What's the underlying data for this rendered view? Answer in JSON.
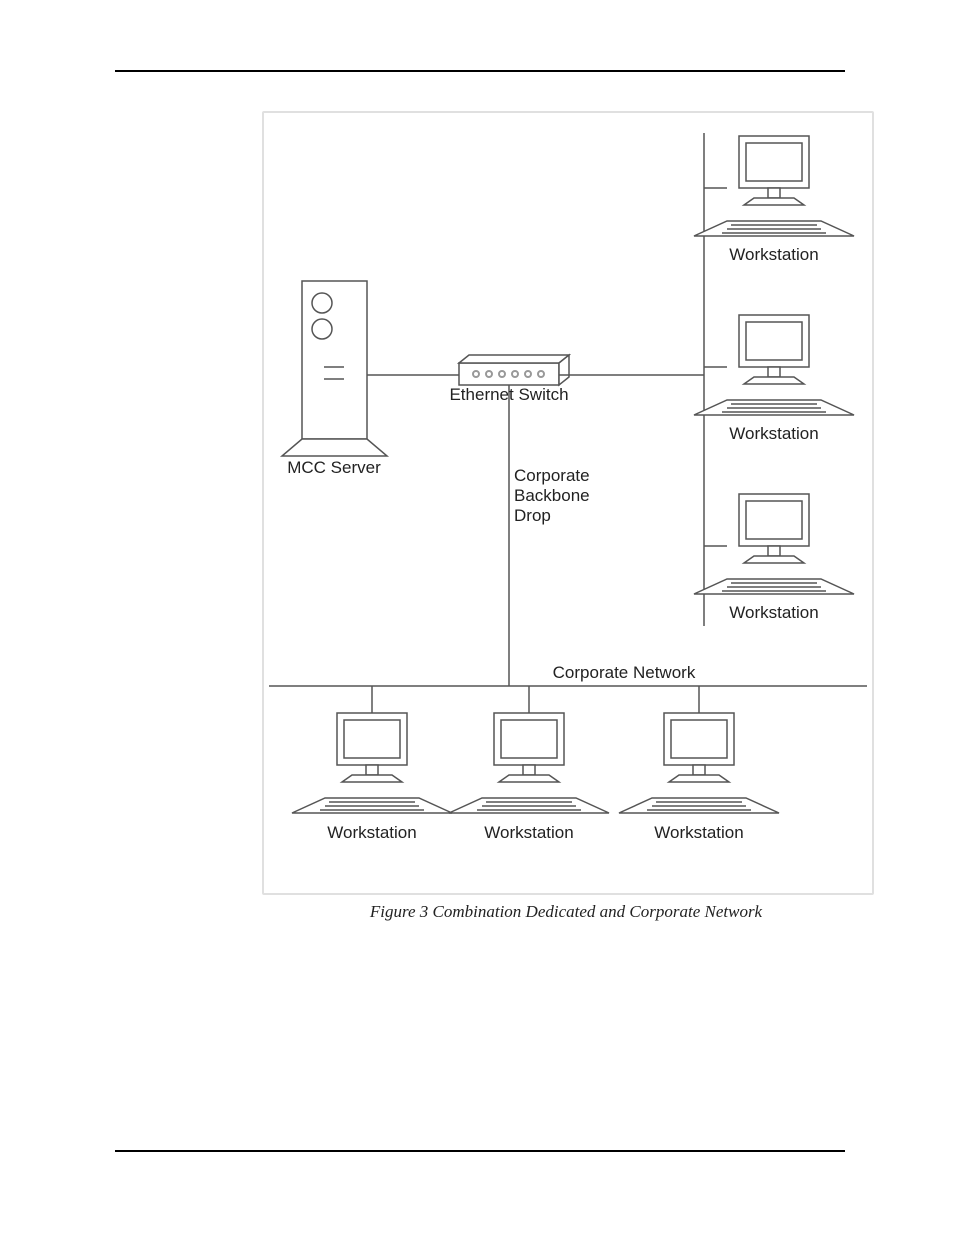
{
  "caption": "Figure 3 Combination Dedicated and Corporate Network",
  "labels": {
    "mccServer": "MCC Server",
    "ethernetSwitch": "Ethernet Switch",
    "backboneDrop": "Corporate\nBackbone\nDrop",
    "corporateNetwork": "Corporate Network",
    "ws1": "Workstation",
    "ws2": "Workstation",
    "ws3": "Workstation",
    "ws4": "Workstation",
    "ws5": "Workstation",
    "ws6": "Workstation"
  }
}
